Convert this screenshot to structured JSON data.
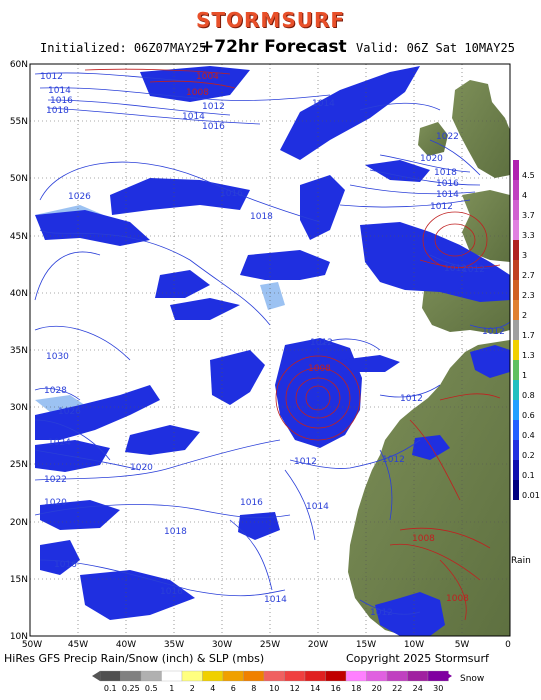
{
  "header": {
    "logo": "STORMSURF",
    "initialized": "Initialized: 06Z07MAY25",
    "forecast": "+72hr Forecast",
    "valid": "Valid: 06Z Sat 10MAY25"
  },
  "footer": {
    "left": "HiRes GFS Precip Rain/Snow (inch) & SLP (mbs)",
    "right": "Copyright 2025 Stormsurf"
  },
  "map": {
    "lat_labels": [
      "60N",
      "55N",
      "50N",
      "45N",
      "40N",
      "35N",
      "30N",
      "25N",
      "20N",
      "15N",
      "10N"
    ],
    "lon_labels": [
      "50W",
      "45W",
      "40W",
      "35W",
      "30W",
      "25W",
      "20W",
      "15W",
      "10W",
      "5W",
      "0"
    ],
    "colors": {
      "ocean": "#ffffff",
      "land": "#6b7f4a",
      "precip": "#1f2fe0",
      "precip_light": "#4a8fe8",
      "isobar": "#2a3fd8",
      "low_isobar": "#c02020"
    },
    "isobar_labels": [
      {
        "text": "1012",
        "color": "blue"
      },
      {
        "text": "1014",
        "color": "blue"
      },
      {
        "text": "1016",
        "color": "blue"
      },
      {
        "text": "1018",
        "color": "blue"
      },
      {
        "text": "1004",
        "color": "red"
      },
      {
        "text": "1008",
        "color": "red"
      },
      {
        "text": "1012",
        "color": "blue"
      },
      {
        "text": "1014",
        "color": "blue"
      },
      {
        "text": "1016",
        "color": "blue"
      },
      {
        "text": "1014",
        "color": "blue"
      },
      {
        "text": "1026",
        "color": "blue"
      },
      {
        "text": "1016",
        "color": "blue"
      },
      {
        "text": "1018",
        "color": "blue"
      },
      {
        "text": "1022",
        "color": "blue"
      },
      {
        "text": "1020",
        "color": "blue"
      },
      {
        "text": "1018",
        "color": "blue"
      },
      {
        "text": "1016",
        "color": "blue"
      },
      {
        "text": "1014",
        "color": "blue"
      },
      {
        "text": "1012",
        "color": "blue"
      },
      {
        "text": "1012",
        "color": "blue"
      },
      {
        "text": "1012",
        "color": "blue"
      },
      {
        "text": "1012",
        "color": "blue"
      },
      {
        "text": "1030",
        "color": "blue"
      },
      {
        "text": "1012",
        "color": "blue"
      },
      {
        "text": "1008",
        "color": "red"
      },
      {
        "text": "1028",
        "color": "blue"
      },
      {
        "text": "1026",
        "color": "blue"
      },
      {
        "text": "1012",
        "color": "blue"
      },
      {
        "text": "1024",
        "color": "blue"
      },
      {
        "text": "1020",
        "color": "blue"
      },
      {
        "text": "1012",
        "color": "blue"
      },
      {
        "text": "1012",
        "color": "blue"
      },
      {
        "text": "1022",
        "color": "blue"
      },
      {
        "text": "1020",
        "color": "blue"
      },
      {
        "text": "1016",
        "color": "blue"
      },
      {
        "text": "1014",
        "color": "blue"
      },
      {
        "text": "1018",
        "color": "blue"
      },
      {
        "text": "1016",
        "color": "blue"
      },
      {
        "text": "1016",
        "color": "blue"
      },
      {
        "text": "1008",
        "color": "red"
      },
      {
        "text": "1014",
        "color": "blue"
      },
      {
        "text": "1008",
        "color": "red"
      },
      {
        "text": "1012",
        "color": "blue"
      }
    ]
  },
  "scale_rain": {
    "label": "Rain",
    "ticks": [
      "4.5",
      "4",
      "3.7",
      "3.3",
      "3",
      "2.7",
      "2.3",
      "2",
      "1.7",
      "1.3",
      "1",
      "0.8",
      "0.6",
      "0.4",
      "0.2",
      "0.1",
      "0.01"
    ],
    "colors": [
      "#b020b0",
      "#c040c0",
      "#d060d0",
      "#e080e0",
      "#b02020",
      "#c04020",
      "#d06020",
      "#e08030",
      "#a0a0a0",
      "#f0d000",
      "#60c060",
      "#20c0c0",
      "#20a0ff",
      "#2060ff",
      "#2030e0",
      "#1010b0",
      "#000080"
    ]
  },
  "scale_snow": {
    "label": "Snow",
    "ticks": [
      "0.1",
      "0.25",
      "0.5",
      "1",
      "2",
      "4",
      "6",
      "8",
      "10",
      "12",
      "14",
      "16",
      "18",
      "20",
      "22",
      "24",
      "30"
    ],
    "colors": [
      "#505050",
      "#808080",
      "#b0b0b0",
      "#ffffff",
      "#ffff80",
      "#f0d000",
      "#f0a000",
      "#f08000",
      "#f06060",
      "#f04040",
      "#e02020",
      "#c00000",
      "#ff80ff",
      "#e060e0",
      "#c040c0",
      "#a020a0",
      "#8000a0"
    ]
  }
}
